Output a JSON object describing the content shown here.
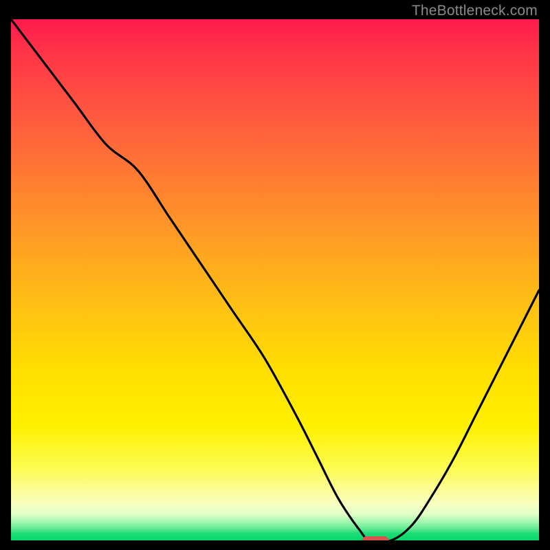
{
  "watermark": "TheBottleneck.com",
  "colors": {
    "frame_bg": "#000000",
    "curve_stroke": "#000000",
    "marker_fill": "#d9534f",
    "gradient_top": "#ff1a4d",
    "gradient_bottom": "#00d868"
  },
  "chart_data": {
    "type": "line",
    "title": "",
    "xlabel": "",
    "ylabel": "",
    "xlim": [
      0,
      100
    ],
    "ylim": [
      0,
      100
    ],
    "grid": false,
    "series": [
      {
        "name": "bottleneck-curve",
        "x": [
          0,
          6,
          12,
          18,
          24,
          30,
          36,
          42,
          48,
          54,
          58,
          62,
          66,
          68,
          72,
          76,
          80,
          84,
          88,
          92,
          96,
          100
        ],
        "values": [
          100,
          92,
          84,
          76,
          71,
          62,
          53,
          44,
          35,
          24,
          16,
          8,
          2,
          0,
          0,
          3,
          9,
          16,
          24,
          32,
          40,
          48
        ]
      }
    ],
    "annotations": [
      {
        "name": "optimal-marker",
        "x": 69,
        "y": 0,
        "width_pct": 5,
        "height_pct": 1.6
      }
    ],
    "legend": false
  }
}
